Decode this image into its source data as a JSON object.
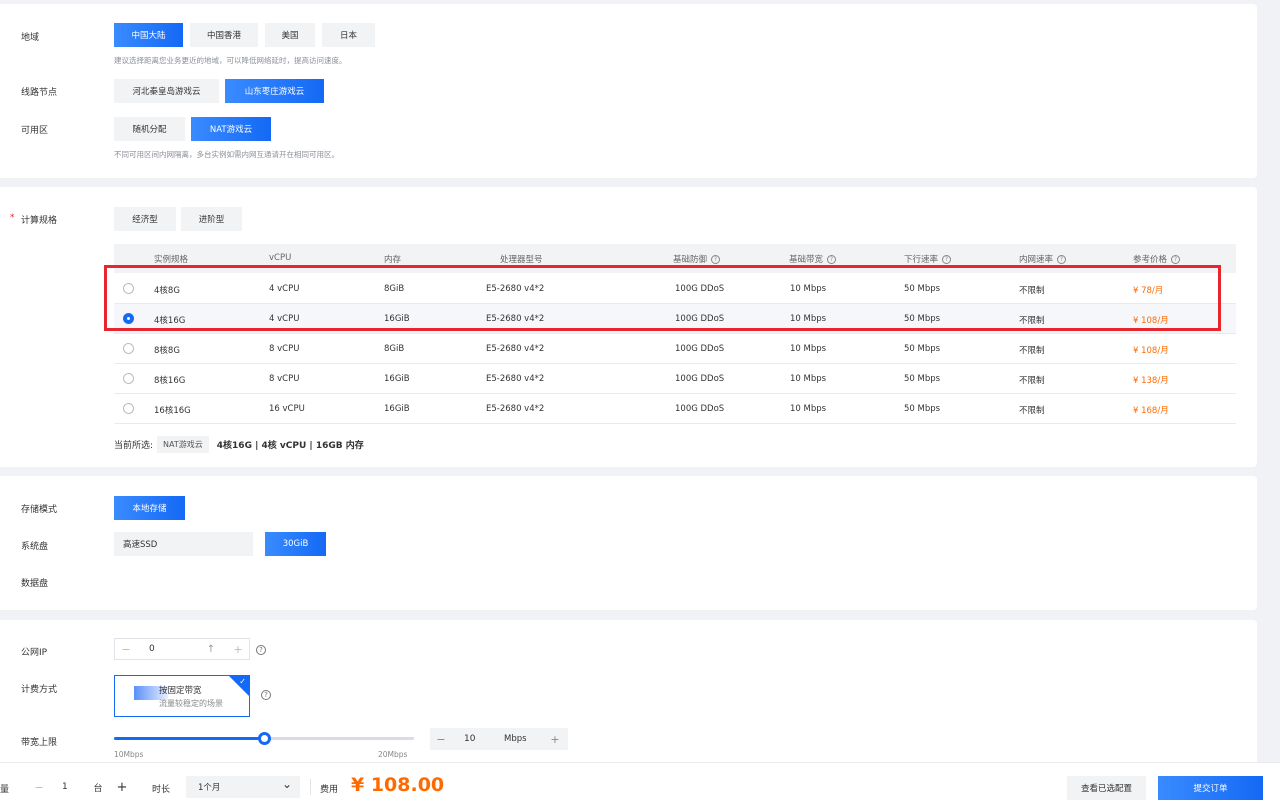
{
  "region": {
    "label": "地域",
    "options": [
      "中国大陆",
      "中国香港",
      "美国",
      "日本"
    ],
    "hint": "建议选择距离您业务更近的地域，可以降低网络延时，提高访问速度。"
  },
  "node": {
    "label": "线路节点",
    "options": [
      "河北秦皇岛游戏云",
      "山东枣庄游戏云"
    ]
  },
  "zone": {
    "label": "可用区",
    "options": [
      "随机分配",
      "NAT游戏云"
    ],
    "hint": "不同可用区间内网隔离，多台实例如需内网互通请开在相同可用区。"
  },
  "spec": {
    "label": "计算规格",
    "required_mark": "*",
    "types": [
      "经济型",
      "进阶型"
    ],
    "columns": [
      "实例规格",
      "vCPU",
      "内存",
      "处理器型号",
      "基础防御",
      "基础带宽",
      "下行速率",
      "内网速率",
      "参考价格"
    ],
    "help_icon": "?",
    "rows": [
      [
        "4核8G",
        "4 vCPU",
        "8GiB",
        "E5-2680 v4*2",
        "100G DDoS",
        "10 Mbps",
        "50 Mbps",
        "不限制",
        "¥ 78/月"
      ],
      [
        "4核16G",
        "4 vCPU",
        "16GiB",
        "E5-2680 v4*2",
        "100G DDoS",
        "10 Mbps",
        "50 Mbps",
        "不限制",
        "¥ 108/月"
      ],
      [
        "8核8G",
        "8 vCPU",
        "8GiB",
        "E5-2680 v4*2",
        "100G DDoS",
        "10 Mbps",
        "50 Mbps",
        "不限制",
        "¥ 108/月"
      ],
      [
        "8核16G",
        "8 vCPU",
        "16GiB",
        "E5-2680 v4*2",
        "100G DDoS",
        "10 Mbps",
        "50 Mbps",
        "不限制",
        "¥ 138/月"
      ],
      [
        "16核16G",
        "16 vCPU",
        "16GiB",
        "E5-2680 v4*2",
        "100G DDoS",
        "10 Mbps",
        "50 Mbps",
        "不限制",
        "¥ 168/月"
      ]
    ],
    "current_label": "当前所选:",
    "current_tag": "NAT游戏云",
    "current_value": "4核16G | 4核 vCPU | 16GB 内存"
  },
  "storage": {
    "mode_label": "存储模式",
    "mode_option": "本地存储",
    "system_label": "系统盘",
    "system_type": "高速SSD",
    "system_size": "30GiB",
    "data_label": "数据盘"
  },
  "network": {
    "ip_label": "公网IP",
    "ip_value": "0",
    "ip_arrow": "↑",
    "ip_minus": "−",
    "ip_plus": "+",
    "help_icon": "?",
    "billing_label": "计费方式",
    "billing_title": "按固定带宽",
    "billing_desc": "流量较稳定的场景",
    "billing_check": "✓",
    "bw_label": "带宽上限",
    "bw_min": "10Mbps",
    "bw_max": "20Mbps",
    "bw_fraction": 0.5,
    "bw_value": "10",
    "bw_unit": "Mbps"
  },
  "footer": {
    "qty_label": "量",
    "qty_value": "1",
    "qty_unit": "台",
    "qty_minus": "−",
    "qty_plus": "+",
    "duration_label": "时长",
    "duration_value": "1个月",
    "dropdown_icon": "⌄",
    "fee_label": "费用",
    "fee_value": "¥ 108.00",
    "view_config": "查看已选配置",
    "submit": "提交订单"
  },
  "colors": {
    "accent": "#1469f5",
    "price": "#ff6a00",
    "highlight_box": "#e8262d"
  }
}
